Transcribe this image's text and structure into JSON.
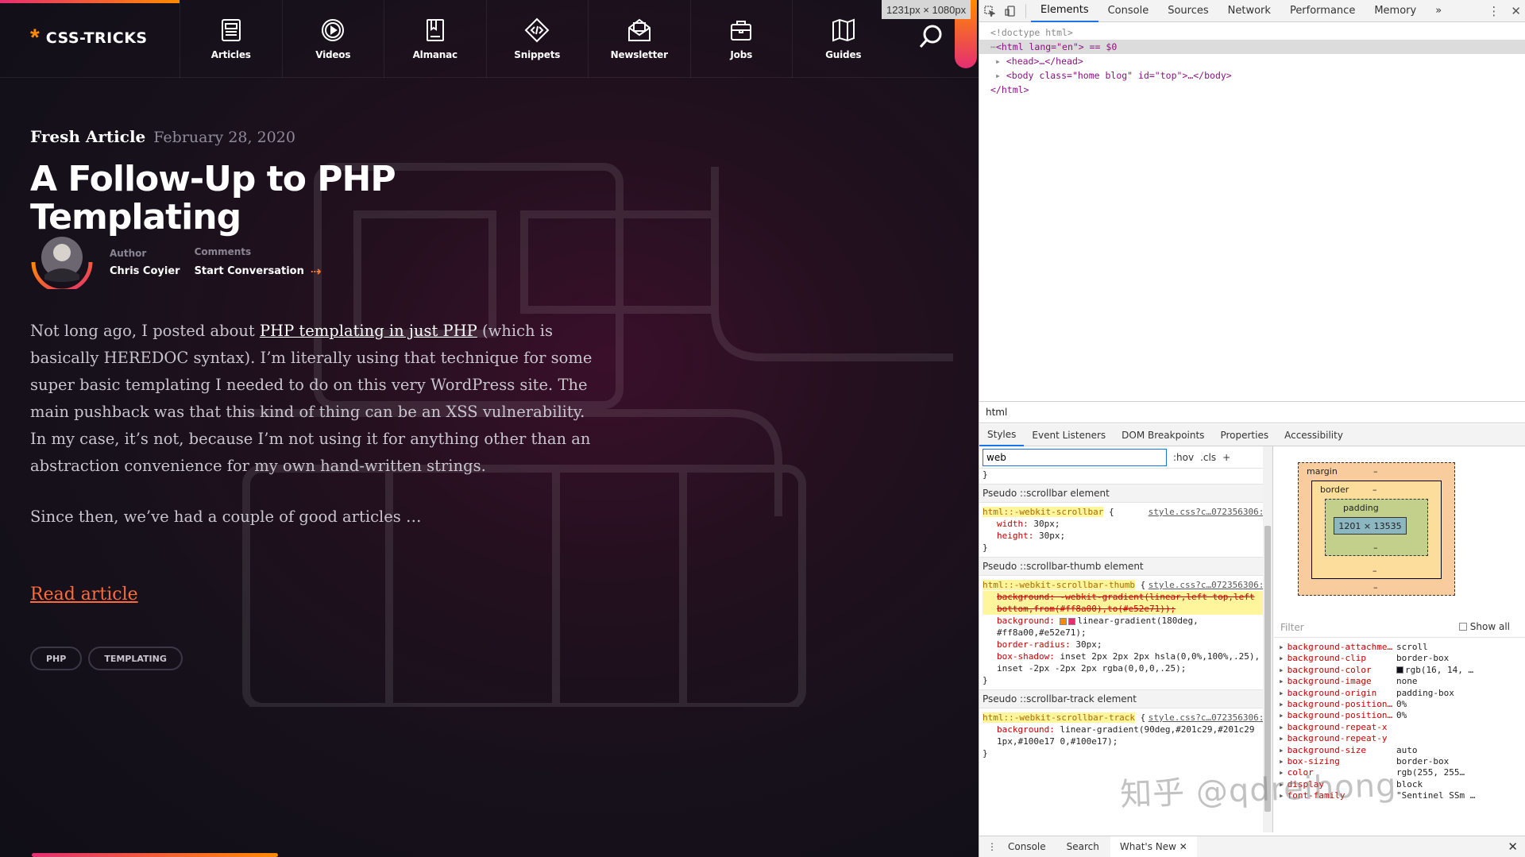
{
  "viewport_badge": "1231px × 1080px",
  "site": {
    "logo": {
      "star": "*",
      "name": "CSS-TRICKS"
    },
    "nav": [
      "Articles",
      "Videos",
      "Almanac",
      "Snippets",
      "Newsletter",
      "Jobs",
      "Guides"
    ],
    "fresh_label": "Fresh Article",
    "date": "February 28, 2020",
    "title": "A Follow-Up to PHP Templating",
    "author_label": "Author",
    "author": "Chris Coyier",
    "comments_label": "Comments",
    "comments_link": "Start Conversation",
    "excerpt": {
      "p1_before": "Not long ago, I posted about ",
      "p1_link": "PHP templating in just PHP",
      "p1_after": " (which is basically HEREDOC syntax). I’m literally using that technique for some super basic templating I needed to do on this very WordPress site. The main pushback was that this kind of thing can be an XSS vulnerability. In my case, it’s not, because I’m not using it for anything other than an abstraction convenience for my own hand-written strings.",
      "p2": "Since then, we’ve had a couple of good articles …"
    },
    "read_more": "Read article",
    "tags": [
      "PHP",
      "TEMPLATING"
    ],
    "colors": {
      "accent_orange": "#ff8a00",
      "accent_pink": "#e52e71",
      "bg": "#100e17"
    }
  },
  "devtools": {
    "tabs": [
      "Elements",
      "Console",
      "Sources",
      "Network",
      "Performance",
      "Memory"
    ],
    "more_tabs": "»",
    "dom": {
      "doctype": "<!doctype html>",
      "html_open": "<html lang=\"en\"> == $0",
      "head": "<head>…</head>",
      "body": "<body class=\"home blog\" id=\"top\">…</body>",
      "html_close": "</html>"
    },
    "breadcrumb": "html",
    "subtabs": [
      "Styles",
      "Event Listeners",
      "DOM Breakpoints",
      "Properties",
      "Accessibility"
    ],
    "filter_value": "web",
    "hov": ":hov",
    "cls": ".cls",
    "plus": "+",
    "rules": [
      {
        "header": "Pseudo ::scrollbar element",
        "selector": "html::-webkit-scrollbar",
        "source": "style.css?c…072356306:5",
        "props": [
          {
            "k": "width",
            "v": "30px;"
          },
          {
            "k": "height",
            "v": "30px;"
          }
        ]
      },
      {
        "header": "Pseudo ::scrollbar-thumb element",
        "selector": "html::-webkit-scrollbar-thumb",
        "source": "style.css?c…072356306:5",
        "struck": "background: -webkit-gradient(linear,left top,left bottom,from(#ff8a00),to(#e52e71));",
        "props": [
          {
            "k": "background",
            "v": "linear-gradient(180deg, #ff8a00,#e52e71);"
          },
          {
            "k": "border-radius",
            "v": "30px;"
          },
          {
            "k": "box-shadow",
            "v": "inset 2px 2px 2px hsla(0,0%,100%,.25), inset -2px -2px 2px rgba(0,0,0,.25);"
          }
        ]
      },
      {
        "header": "Pseudo ::scrollbar-track element",
        "selector": "html::-webkit-scrollbar-track",
        "source": "style.css?c…072356306:5",
        "props": [
          {
            "k": "background",
            "v": "linear-gradient(90deg,#201c29,#201c29 1px,#100e17 0,#100e17);"
          }
        ]
      }
    ],
    "boxmodel": {
      "margin": "margin",
      "border": "border",
      "padding": "padding",
      "content": "1201 × 13535",
      "dash": "–"
    },
    "computed_filter": "Filter",
    "show_all": "Show all",
    "computed": [
      {
        "k": "background-attachme…",
        "v": "scroll"
      },
      {
        "k": "background-clip",
        "v": "border-box"
      },
      {
        "k": "background-color",
        "v": "rgb(16, 14, …"
      },
      {
        "k": "background-image",
        "v": "none"
      },
      {
        "k": "background-origin",
        "v": "padding-box"
      },
      {
        "k": "background-position…",
        "v": "0%"
      },
      {
        "k": "background-position…",
        "v": "0%"
      },
      {
        "k": "background-repeat-x",
        "v": ""
      },
      {
        "k": "background-repeat-y",
        "v": ""
      },
      {
        "k": "background-size",
        "v": "auto"
      },
      {
        "k": "box-sizing",
        "v": "border-box"
      },
      {
        "k": "color",
        "v": "rgb(255, 255…"
      },
      {
        "k": "display",
        "v": "block"
      },
      {
        "k": "font-family",
        "v": "\"Sentinel SSm …"
      }
    ],
    "drawer_tabs": [
      "Console",
      "Search",
      "What's New"
    ],
    "close": "✕"
  },
  "watermark": "知乎 @qdreihong"
}
